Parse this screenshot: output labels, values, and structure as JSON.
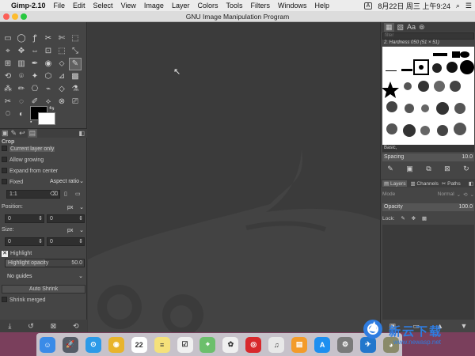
{
  "menubar": {
    "apple": "",
    "app_name": "Gimp-2.10",
    "items": [
      "File",
      "Edit",
      "Select",
      "View",
      "Image",
      "Layer",
      "Colors",
      "Tools",
      "Filters",
      "Windows",
      "Help"
    ],
    "input_badge": "A",
    "clock": "8月22日 周三 上午9:24"
  },
  "window": {
    "title": "GNU Image Manipulation Program"
  },
  "toolbox": {
    "tools": [
      "▭",
      "◯",
      "ꝭ",
      "✂",
      "✄",
      "⬚",
      "⌖",
      "✥",
      "⇔",
      "⊡",
      "⬚",
      "⤡",
      "⊞",
      "▥",
      "✒",
      "◉",
      "⬦",
      "✎",
      "⟲",
      "⌾",
      "✦",
      "⬡",
      "⊿",
      "▩",
      "⁂",
      "✏",
      "⎔",
      "⌁",
      "◇",
      "⚗",
      "✂",
      "◌",
      "✐",
      "⟡",
      "⊗",
      "⎚",
      "⍥",
      "◐",
      "⎊"
    ],
    "tabs": [
      "▣",
      "✎",
      "↩",
      "▤"
    ],
    "active_tab": 3,
    "crop": {
      "title": "Crop",
      "current_layer_only": "Current layer only",
      "allow_growing": "Allow growing",
      "expand_from_center": "Expand from center",
      "fixed_label": "Fixed",
      "aspect_ratio": "Aspect ratio",
      "ratio_value": "1:1",
      "position_label": "Position:",
      "position_unit": "px",
      "pos_x": "0",
      "pos_y": "0",
      "size_label": "Size:",
      "size_unit": "px",
      "size_w": "0",
      "size_h": "0",
      "highlight": "Highlight",
      "highlight_opacity_label": "Highlight opacity",
      "highlight_opacity_value": "50.0",
      "highlight_opacity": 0.5,
      "guides": "No guides",
      "auto_shrink": "Auto Shrink",
      "shrink_merged": "Shrink merged"
    }
  },
  "dock": {
    "brushes": {
      "filter_placeholder": "filter",
      "name": "2. Hardness 050 (51 × 51)",
      "tag": "Basic,",
      "spacing_label": "Spacing",
      "spacing_value": "10.0"
    },
    "layers": {
      "tabs": [
        "Layers",
        "Channels",
        "Paths"
      ],
      "mode_label": "Mode",
      "mode_value": "Normal",
      "opacity_label": "Opacity",
      "opacity_value": "100.0",
      "lock_label": "Lock:"
    }
  },
  "macdock": {
    "apps": [
      {
        "name": "finder",
        "color": "#3a8be8",
        "glyph": "☺"
      },
      {
        "name": "launchpad",
        "color": "#555b66",
        "glyph": "🚀"
      },
      {
        "name": "safari",
        "color": "#2c9ae8",
        "glyph": "⊙"
      },
      {
        "name": "chrome",
        "color": "#e8b42c",
        "glyph": "◉"
      },
      {
        "name": "calendar",
        "color": "#ffffff",
        "glyph": "22"
      },
      {
        "name": "notes",
        "color": "#f5e17a",
        "glyph": "≡"
      },
      {
        "name": "reminders",
        "color": "#f0f0f0",
        "glyph": "☑"
      },
      {
        "name": "maps",
        "color": "#6cbf6c",
        "glyph": "⌖"
      },
      {
        "name": "photos",
        "color": "#f0f0f0",
        "glyph": "✿"
      },
      {
        "name": "netease-music",
        "color": "#d8282c",
        "glyph": "◎"
      },
      {
        "name": "itunes",
        "color": "#e8e8e8",
        "glyph": "♫"
      },
      {
        "name": "ibooks",
        "color": "#f39b2a",
        "glyph": "▤"
      },
      {
        "name": "app-store",
        "color": "#1d8ff0",
        "glyph": "A"
      },
      {
        "name": "system-preferences",
        "color": "#7a7a7a",
        "glyph": "⚙"
      },
      {
        "name": "xcode",
        "color": "#2277cc",
        "glyph": "✈"
      },
      {
        "name": "gimp",
        "color": "#8a8a6a",
        "glyph": "◕"
      }
    ]
  },
  "watermark": {
    "text_cn": "新云下载",
    "text_url": "www.newasp.net"
  }
}
